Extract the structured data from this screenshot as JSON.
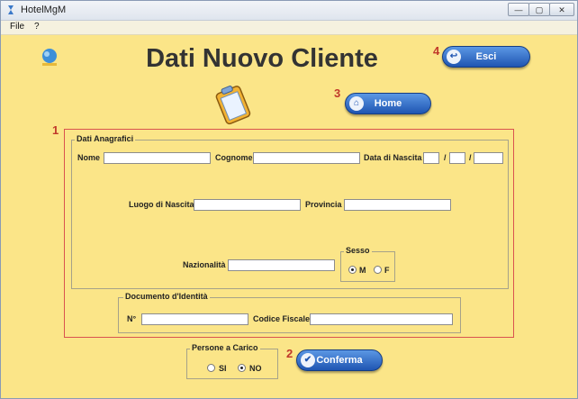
{
  "window": {
    "title": "HotelMgM",
    "min_glyph": "—",
    "max_glyph": "▢",
    "close_glyph": "✕"
  },
  "menu": {
    "items": [
      "File",
      "?"
    ]
  },
  "header": {
    "title": "Dati Nuovo Cliente"
  },
  "markers": {
    "anagrafici": "1",
    "conferma": "2",
    "home": "3",
    "esci": "4"
  },
  "buttons": {
    "esci": "Esci",
    "home": "Home",
    "conferma": "Conferma"
  },
  "anagrafici": {
    "legend": "Dati Anagrafici",
    "nome_label": "Nome",
    "nome_value": "",
    "cognome_label": "Cognome",
    "cognome_value": "",
    "nascita_label": "Data di Nascita",
    "nascita_sep": "/",
    "nascita_giorno": "",
    "nascita_mese": "",
    "nascita_anno": "",
    "luogo_label": "Luogo di Nascita",
    "luogo_value": "",
    "provincia_label": "Provincia",
    "provincia_value": "",
    "nazionalita_label": "Nazionalità",
    "nazionalita_value": "",
    "sesso": {
      "legend": "Sesso",
      "options": [
        "M",
        "F"
      ],
      "selected": "M"
    }
  },
  "documento": {
    "legend": "Documento d'Identità",
    "numero_label": "N°",
    "numero_value": "",
    "cf_label": "Codice Fiscale",
    "cf_value": ""
  },
  "persone": {
    "legend": "Persone a Carico",
    "options": [
      "SI",
      "NO"
    ],
    "selected": "NO"
  },
  "colors": {
    "background": "#fbe588",
    "accent": "#1f55b2",
    "marker": "#c0392b"
  }
}
